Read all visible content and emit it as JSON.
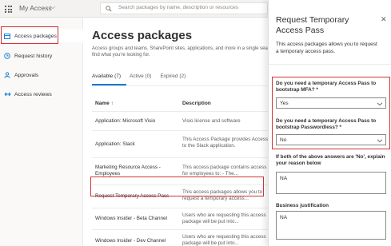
{
  "app": {
    "title": "My Access",
    "search_placeholder": "Search packages by name, description or resources"
  },
  "sidebar": {
    "items": [
      {
        "label": "Access packages",
        "icon": "package-icon"
      },
      {
        "label": "Request history",
        "icon": "history-icon"
      },
      {
        "label": "Approvals",
        "icon": "person-icon"
      },
      {
        "label": "Access reviews",
        "icon": "review-icon"
      }
    ]
  },
  "main": {
    "title": "Access packages",
    "description": "Access groups and teams, SharePoint sites, applications, and more in a single search to find what you're looking for.",
    "tabs": [
      {
        "label": "Available (7)"
      },
      {
        "label": "Active (0)"
      },
      {
        "label": "Expired (2)"
      }
    ],
    "columns": {
      "name": "Name ↑",
      "description": "Description"
    },
    "rows": [
      {
        "name": "Application: Microsoft Visio",
        "description": "Visio license and software"
      },
      {
        "name": "Application: Slack",
        "description": "This Access Package provides Access to the Slack application."
      },
      {
        "name": "Marketing Resource Access - Employees",
        "description": "This access package contains access for employees to: - The..."
      },
      {
        "name": "Request Temporary Access Pass",
        "description": "This access packages allows you to request a temporary access..."
      },
      {
        "name": "Windows Insider - Beta Channel",
        "description": "Users who are requesting this access package will be put into..."
      },
      {
        "name": "Windows Insider - Dev Channel",
        "description": "Users who are requesting this access package will be put into..."
      }
    ]
  },
  "panel": {
    "title": "Request Temporary Access Pass",
    "close": "✕",
    "description": "This access packages allows you to request a temporary access pass.",
    "q1": {
      "label": "Do you need a temporary Access Pass to bootstrap MFA? *",
      "value": "Yes"
    },
    "q2": {
      "label": "Do you need a temporary Access Pass to bootstrap Passwordless? *",
      "value": "No"
    },
    "q3": {
      "label": "If both of the above answers are 'No', explain your reason below",
      "value": "NA"
    },
    "q4": {
      "label": "Business justification",
      "value": "NA"
    }
  },
  "colors": {
    "accent": "#0078d4",
    "highlight": "#d13438"
  }
}
